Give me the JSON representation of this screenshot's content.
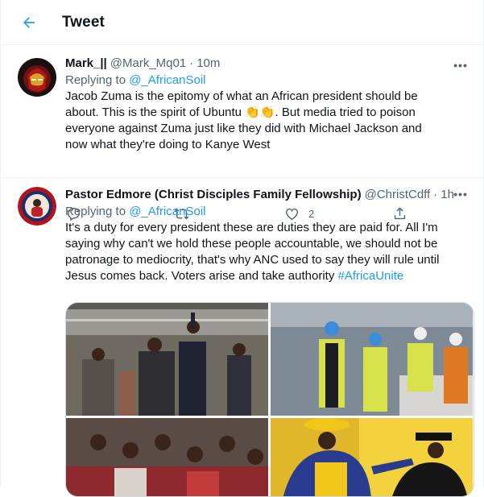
{
  "header": {
    "title": "Tweet"
  },
  "tweets": [
    {
      "name": "Mark_||",
      "handle": "@Mark_Mq01",
      "time": "10m",
      "replying_prefix": "Replying to",
      "replying_to": "@_AfricanSoil",
      "text_part1": "Jacob Zuma is the epitomy of what an African president should be about. This is the spirit of Ubuntu",
      "text_part2": ". But media tried to poison everyone against Zuma just like they did with Michael Jackson and now what they're doing to Kanye West",
      "likes": "2"
    },
    {
      "name": "Pastor Edmore (Christ Disciples Family Fellowship)",
      "handle": "@ChristCdff",
      "time": "1h",
      "replying_prefix": "Replying to",
      "replying_to": "@_AfricanSoil",
      "text": "It's a duty for every president these are duties they are paid for. All I'm saying why can't we hold these people accountable, we should not be patronage to mediocrity, that's why ANC used to say they will rule until Jesus comes back. Voters arise and take authority ",
      "hashtag": "#AfricaUnite"
    }
  ],
  "icons": {
    "back": "arrow-left-icon",
    "more": "more-icon",
    "reply": "reply-icon",
    "retweet": "retweet-icon",
    "like": "heart-icon",
    "share": "share-icon"
  },
  "colors": {
    "accent": "#1d9bf0",
    "secondary": "#536471",
    "text": "#0f1419"
  }
}
